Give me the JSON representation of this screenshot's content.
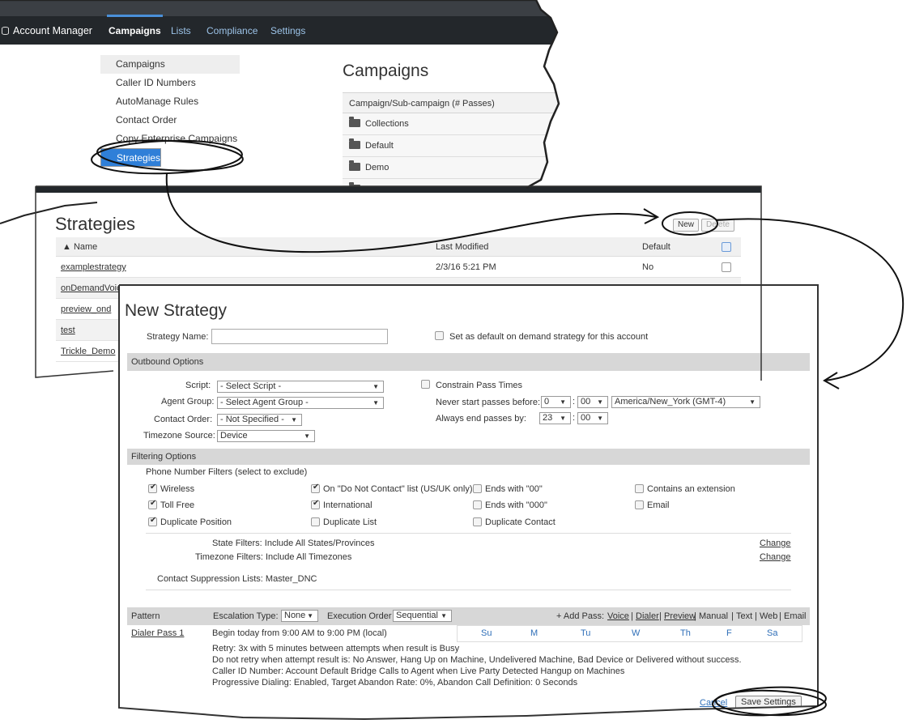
{
  "nav": {
    "brand": "Account Manager",
    "items": [
      "Campaigns",
      "Lists",
      "Compliance",
      "Settings"
    ],
    "active": "Campaigns"
  },
  "submenu": [
    "Campaigns",
    "Caller ID Numbers",
    "AutoManage Rules",
    "Contact Order",
    "Copy Enterprise Campaigns",
    "Strategies"
  ],
  "campaigns": {
    "title": "Campaigns",
    "header": "Campaign/Sub-campaign (# Passes)",
    "folders": [
      "Collections",
      "Default",
      "Demo"
    ]
  },
  "strategies": {
    "title": "Strategies",
    "new_label": "New",
    "delete_label": "Delete",
    "columns": {
      "name": "▲ Name",
      "modified": "Last Modified",
      "default": "Default"
    },
    "rows": [
      {
        "name": "examplestrategy",
        "modified": "2/3/16 5:21 PM",
        "default": "No"
      },
      {
        "name": "onDemandVoice",
        "modified": "",
        "default": ""
      },
      {
        "name": "preview_ond",
        "modified": "",
        "default": ""
      },
      {
        "name": "test",
        "modified": "",
        "default": ""
      },
      {
        "name": "Trickle_Demo",
        "modified": "",
        "default": ""
      }
    ]
  },
  "new_strategy": {
    "title": "New Strategy",
    "name_label": "Strategy Name:",
    "default_checkbox": "Set as default on demand strategy for this account",
    "outbound": {
      "section": "Outbound Options",
      "script_label": "Script:",
      "script_value": "- Select Script -",
      "agent_label": "Agent Group:",
      "agent_value": "- Select Agent Group -",
      "order_label": "Contact Order:",
      "order_value": "- Not Specified -",
      "tz_label": "Timezone Source:",
      "tz_value": "Device",
      "constrain": "Constrain Pass Times",
      "never_label": "Never start passes before:",
      "never_hour": "0",
      "never_min": "00",
      "zone": "America/New_York (GMT-4)",
      "always_label": "Always end passes by:",
      "always_hour": "23",
      "always_min": "00"
    },
    "filtering": {
      "section": "Filtering Options",
      "phone_label": "Phone Number Filters (select to exclude)",
      "filters": {
        "wireless": "Wireless",
        "dnc": "On \"Do Not Contact\" list (US/UK only)",
        "ends00": "Ends with \"00\"",
        "extension": "Contains an extension",
        "tollfree": "Toll Free",
        "international": "International",
        "ends000": "Ends with \"000\"",
        "email": "Email",
        "dup_position": "Duplicate Position",
        "dup_list": "Duplicate List",
        "dup_contact": "Duplicate Contact"
      },
      "state_filters": "State Filters: Include All States/Provinces",
      "tz_filters": "Timezone Filters: Include All Timezones",
      "change": "Change",
      "suppression": "Contact Suppression Lists: Master_DNC"
    },
    "pattern": {
      "label": "Pattern",
      "escalation_label": "Escalation Type:",
      "escalation_value": "None",
      "exec_label": "Execution Order",
      "exec_value": "Sequential",
      "add_pass": "+ Add Pass:",
      "pass_types": [
        "Voice",
        "Dialer",
        "Preview",
        "Manual",
        "Text",
        "Web",
        "Email"
      ],
      "pass_name": "Dialer Pass 1",
      "begin": "Begin today from  9:00 AM to 9:00 PM (local)",
      "days": [
        "Su",
        "M",
        "Tu",
        "W",
        "Th",
        "F",
        "Sa"
      ],
      "details": [
        "Retry: 3x with 5 minutes between attempts when result is Busy",
        "Do not retry when attempt result is: No Answer, Hang Up on Machine, Undelivered Machine, Bad Device or Delivered without success.",
        "Caller ID Number: Account Default    Bridge Calls to Agent when Live Party Detected     Hangup on Machines",
        "Progressive Dialing: Enabled, Target Abandon Rate: 0%, Abandon Call Definition: 0 Seconds"
      ]
    },
    "cancel": "Cancel",
    "save": "Save Settings"
  }
}
